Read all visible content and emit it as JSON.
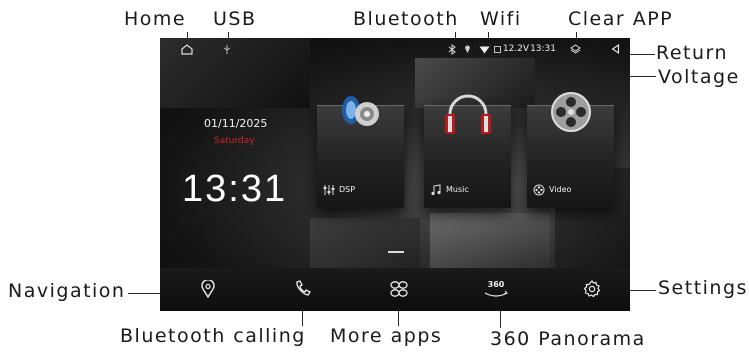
{
  "callouts": {
    "home": "Home",
    "usb": "USB",
    "bluetooth": "Bluetooth",
    "wifi": "Wifi",
    "clear_app": "Clear APP",
    "return": "Return",
    "voltage": "Voltage",
    "navigation": "Navigation",
    "settings": "Settings",
    "bluetooth_calling": "Bluetooth calling",
    "more_apps": "More apps",
    "panorama": "360 Panorama"
  },
  "status_bar": {
    "voltage": "12.2V",
    "time": "13:31"
  },
  "widget": {
    "date": "01/11/2025",
    "weekday": "Saturday",
    "clock": "13:31"
  },
  "cards": [
    {
      "label": "DSP",
      "icon": "equalizer-icon"
    },
    {
      "label": "Music",
      "icon": "music-note-icon"
    },
    {
      "label": "Video",
      "icon": "film-reel-icon"
    }
  ],
  "dock": {
    "panorama_badge": "360"
  },
  "colors": {
    "accent_red": "#c62828",
    "screen_bg": "#141414",
    "text_light": "#f0f0f0"
  }
}
